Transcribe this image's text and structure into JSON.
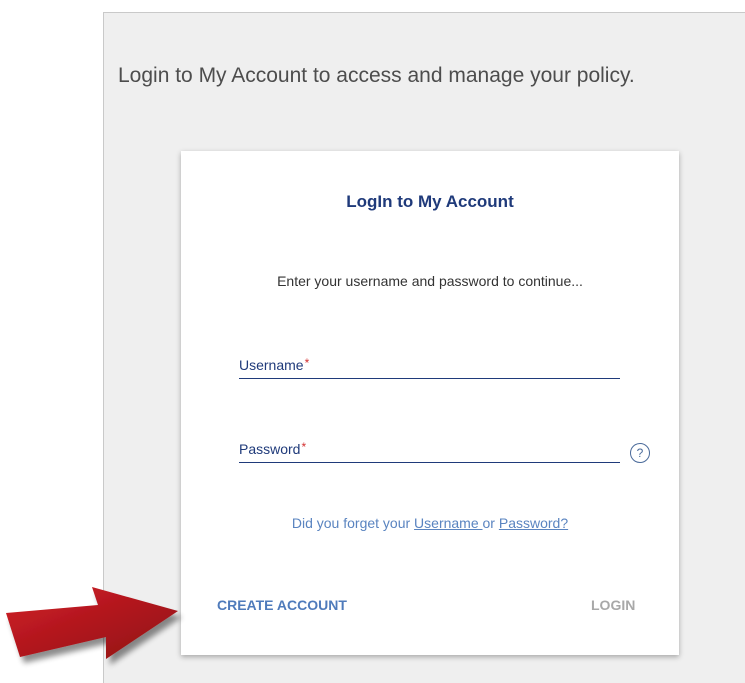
{
  "intro_text": "Login to My Account to access and manage your policy.",
  "card": {
    "title": "LogIn to My Account",
    "subtitle": "Enter your username and password to continue...",
    "username_label": "Username",
    "password_label": "Password",
    "required_mark": "*",
    "help_symbol": "?",
    "forgot": {
      "prefix": "Did you forget your ",
      "username_link": "Username ",
      "middle": "or ",
      "password_link": "Password?"
    },
    "create_account_label": "CREATE ACCOUNT",
    "login_label": "LOGIN"
  },
  "icons": {
    "help": "question-circle-icon",
    "annotation": "red-arrow-icon"
  },
  "colors": {
    "title": "#1f3a7a",
    "link": "#5a84c0",
    "required": "#d32f2f",
    "arrow": "#b3171d",
    "login_disabled": "#a8a8a8"
  }
}
